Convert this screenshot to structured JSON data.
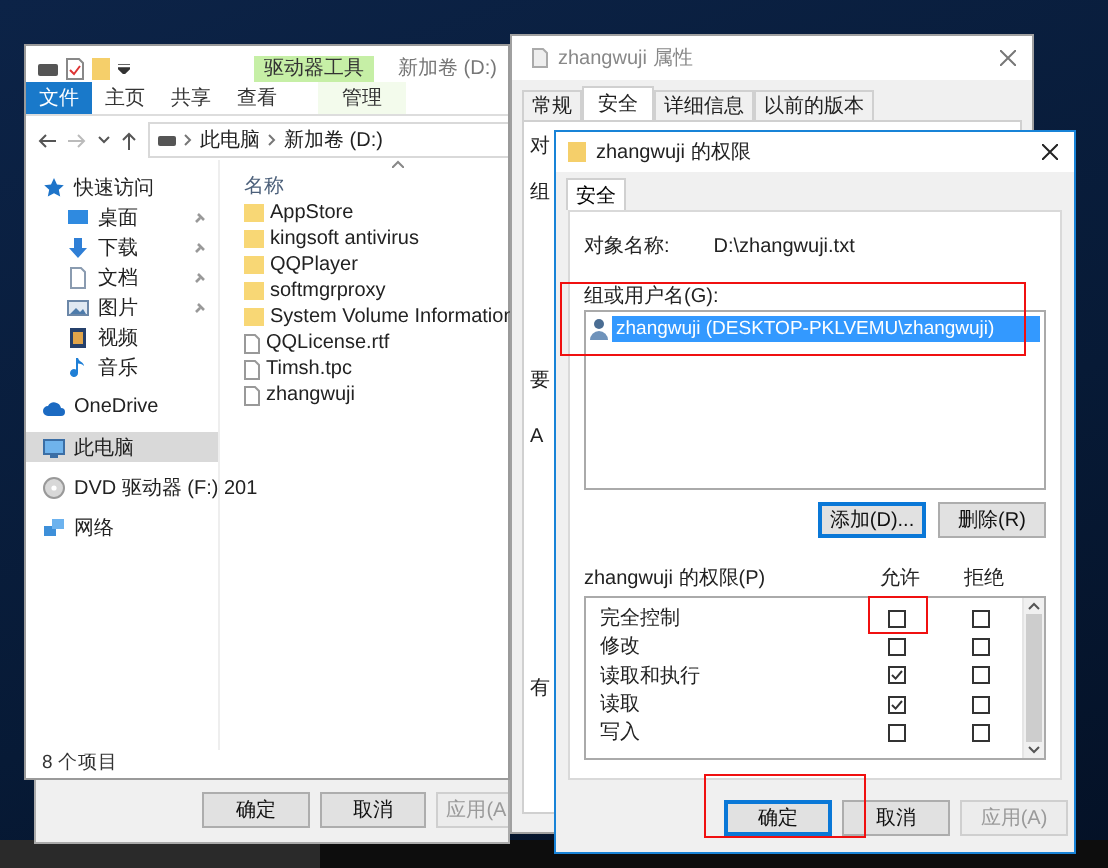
{
  "explorer": {
    "context_tab": "驱动器工具",
    "title": "新加卷 (D:)",
    "ribbon_tabs": [
      {
        "label": "文件",
        "kind": "file"
      },
      {
        "label": "主页",
        "kind": "plain"
      },
      {
        "label": "共享",
        "kind": "plain"
      },
      {
        "label": "查看",
        "kind": "plain"
      },
      {
        "label": "管理",
        "kind": "context"
      }
    ],
    "breadcrumb": [
      "此电脑",
      "新加卷 (D:)"
    ],
    "column_header": "名称",
    "nav_items": [
      {
        "label": "快速访问",
        "kind": "star",
        "selected": false,
        "children": [
          {
            "label": "桌面",
            "kind": "desktop",
            "pinned": true,
            "selected": false
          },
          {
            "label": "下载",
            "kind": "download",
            "pinned": true,
            "selected": false
          },
          {
            "label": "文档",
            "kind": "document",
            "pinned": true,
            "selected": false
          },
          {
            "label": "图片",
            "kind": "picture",
            "pinned": true,
            "selected": false
          },
          {
            "label": "视频",
            "kind": "video",
            "pinned": false,
            "selected": false
          },
          {
            "label": "音乐",
            "kind": "music",
            "pinned": false,
            "selected": false
          }
        ]
      },
      {
        "label": "OneDrive",
        "kind": "cloud",
        "selected": false
      },
      {
        "label": "此电脑",
        "kind": "computer",
        "selected": true
      },
      {
        "label": "DVD 驱动器 (F:) 201",
        "kind": "disc",
        "selected": false
      },
      {
        "label": "网络",
        "kind": "network",
        "selected": false
      }
    ],
    "files": [
      {
        "name": "AppStore",
        "kind": "folder"
      },
      {
        "name": "kingsoft antivirus",
        "kind": "folder"
      },
      {
        "name": "QQPlayer",
        "kind": "folder"
      },
      {
        "name": "softmgrproxy",
        "kind": "folder"
      },
      {
        "name": "System Volume Information",
        "kind": "folder"
      },
      {
        "name": "QQLicense.rtf",
        "kind": "file"
      },
      {
        "name": "Timsh.tpc",
        "kind": "file"
      },
      {
        "name": "zhangwuji",
        "kind": "file"
      }
    ],
    "status": "8 个项目"
  },
  "back_dialog": {
    "buttons": [
      {
        "label": "确定",
        "disabled": false
      },
      {
        "label": "取消",
        "disabled": false
      },
      {
        "label": "应用(A",
        "disabled": true
      }
    ]
  },
  "properties": {
    "title": "zhangwuji 属性",
    "tabs": [
      {
        "label": "常规",
        "selected": false
      },
      {
        "label": "安全",
        "selected": true
      },
      {
        "label": "详细信息",
        "selected": false
      },
      {
        "label": "以前的版本",
        "selected": false
      }
    ],
    "peek_texts": [
      "对",
      "组",
      "要",
      "A",
      "有"
    ]
  },
  "permissions": {
    "title": "zhangwuji 的权限",
    "tab": "安全",
    "object_label": "对象名称:",
    "object_value": "D:\\zhangwuji.txt",
    "users_label": "组或用户名(G):",
    "users": [
      {
        "name": "zhangwuji (DESKTOP-PKLVEMU\\zhangwuji)",
        "selected": true
      }
    ],
    "user_buttons": [
      {
        "label": "添加(D)...",
        "focused": true
      },
      {
        "label": "删除(R)",
        "focused": false
      }
    ],
    "rights_label": "zhangwuji 的权限(P)",
    "allow_header": "允许",
    "deny_header": "拒绝",
    "rights": [
      {
        "name": "完全控制",
        "allow": false,
        "deny": false
      },
      {
        "name": "修改",
        "allow": false,
        "deny": false
      },
      {
        "name": "读取和执行",
        "allow": true,
        "deny": false
      },
      {
        "name": "读取",
        "allow": true,
        "deny": false
      },
      {
        "name": "写入",
        "allow": false,
        "deny": false
      }
    ],
    "buttons": [
      {
        "label": "确定",
        "focused": true,
        "disabled": false
      },
      {
        "label": "取消",
        "focused": false,
        "disabled": false
      },
      {
        "label": "应用(A)",
        "focused": false,
        "disabled": true
      }
    ]
  }
}
